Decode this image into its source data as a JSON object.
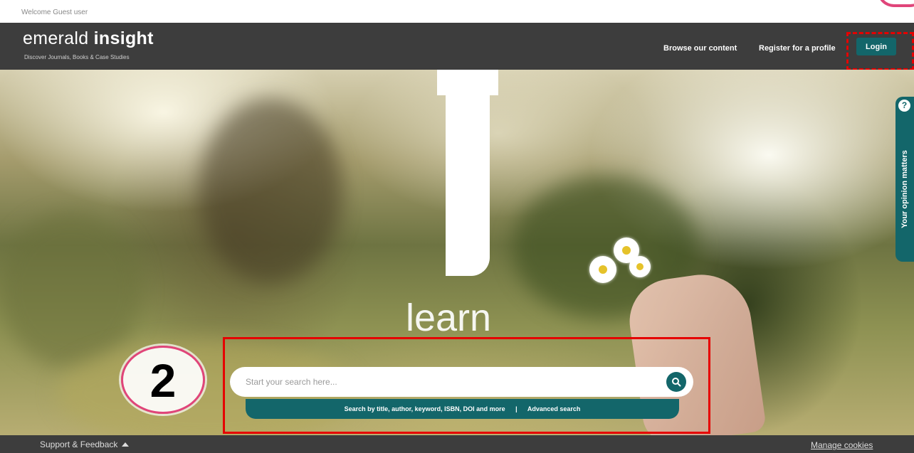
{
  "welcome": {
    "text": "Welcome Guest user"
  },
  "header": {
    "logo_light": "emerald",
    "logo_bold": "insight",
    "tagline": "Discover Journals, Books & Case Studies",
    "nav": {
      "browse": "Browse our content",
      "register": "Register for a profile"
    },
    "login_label": "Login"
  },
  "hero": {
    "word": "learn"
  },
  "search": {
    "placeholder": "Start your search here...",
    "hint": "Search by title, author, keyword, ISBN, DOI and more",
    "separator": "|",
    "advanced_label": "Advanced search",
    "search_icon": "search-icon"
  },
  "annotation": {
    "step_number": "2",
    "highlight_color": "#e60000",
    "badge_color": "#e0457a"
  },
  "feedback_tab": {
    "icon": "?",
    "label": "Your opinion matters"
  },
  "footer": {
    "support": "Support & Feedback",
    "cookies": "Manage cookies"
  },
  "colors": {
    "header_bg": "#3d3d3d",
    "accent": "#13666a"
  }
}
